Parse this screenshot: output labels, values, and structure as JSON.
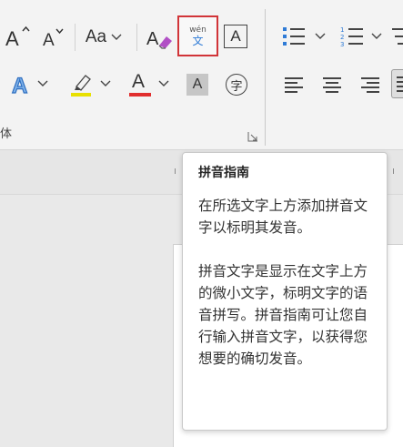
{
  "ribbon": {
    "grow_font_icon": "grow-font",
    "shrink_font_icon": "shrink-font",
    "change_case_label": "Aa",
    "clear_formatting_icon": "clear-all-formatting",
    "phonetic_guide": {
      "top_text": "wén",
      "bottom_text": "文"
    },
    "character_border_label": "A",
    "text_effects_label": "A",
    "highlight_color": "#e8e000",
    "font_color_label": "A",
    "font_color": "#e12e2e",
    "character_shading_label": "A",
    "enclose_character_label": "字",
    "group_label_partial": "体",
    "accent_color": "#d13438"
  },
  "tooltip": {
    "title": "拼音指南",
    "paragraph1": "在所选文字上方添加拼音文字以标明其发音。",
    "paragraph2": "拼音文字是显示在文字上方的微小文字，标明文字的语音拼写。拼音指南可让您自行输入拼音文字，以获得您想要的确切发音。"
  }
}
